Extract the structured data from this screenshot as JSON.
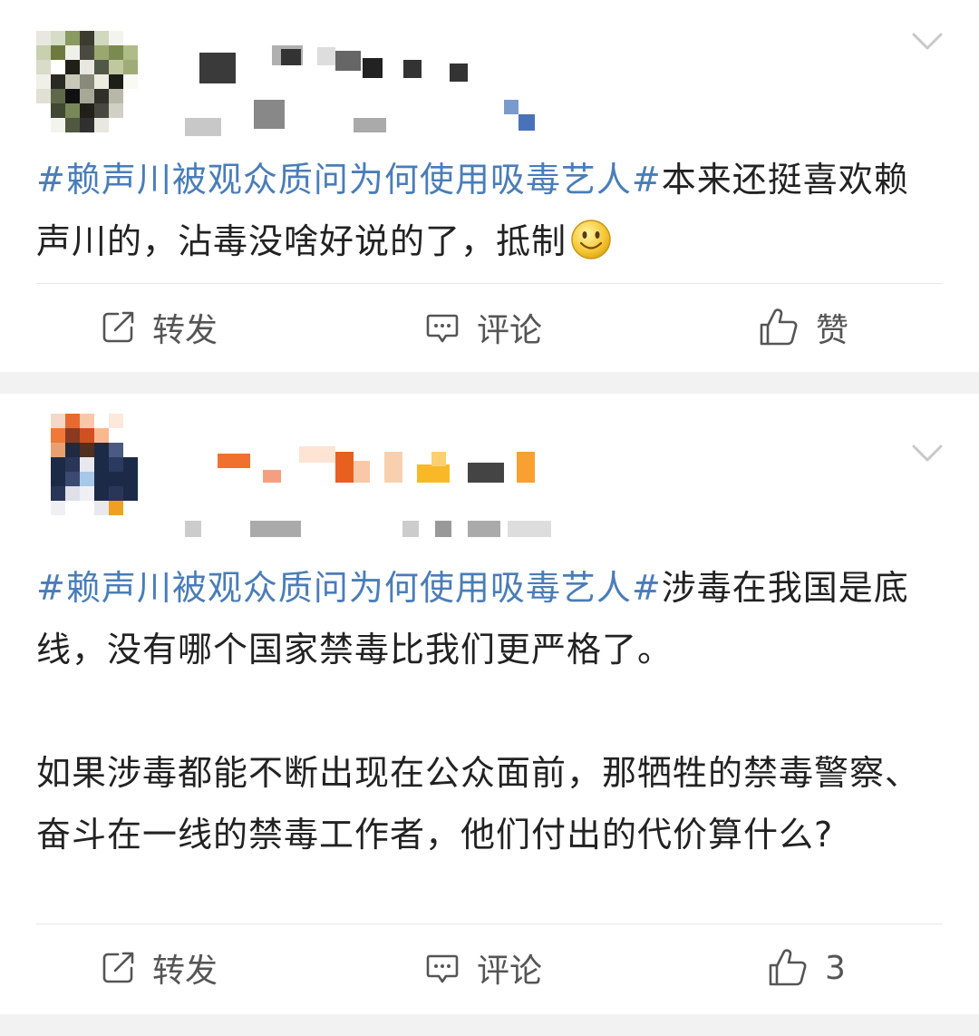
{
  "posts": [
    {
      "hashtag": "#赖声川被观众质问为何使用吸毒艺人#",
      "text": "本来还挺喜欢赖声川的，沾毒没啥好说的了，抵制",
      "emoji": "smile-emoji",
      "actions": {
        "repost": "转发",
        "comment": "评论",
        "like": "赞"
      }
    },
    {
      "hashtag": "#赖声川被观众质问为何使用吸毒艺人#",
      "paragraphs": [
        "涉毒在我国是底线，没有哪个国家禁毒比我们更严格了。",
        "如果涉毒都能不断出现在公众面前，那牺牲的禁毒警察、奋斗在一线的禁毒工作者，他们付出的代价算什么?"
      ],
      "actions": {
        "repost": "转发",
        "comment": "评论",
        "like": "3"
      }
    }
  ],
  "icons": {
    "repost": "repost-icon",
    "comment": "comment-icon",
    "like": "thumbs-up-icon",
    "menu": "chevron-down-icon"
  },
  "colors": {
    "hashtag": "#4a7db8",
    "text": "#222222",
    "action_text": "#555555",
    "background": "#f2f2f2"
  }
}
